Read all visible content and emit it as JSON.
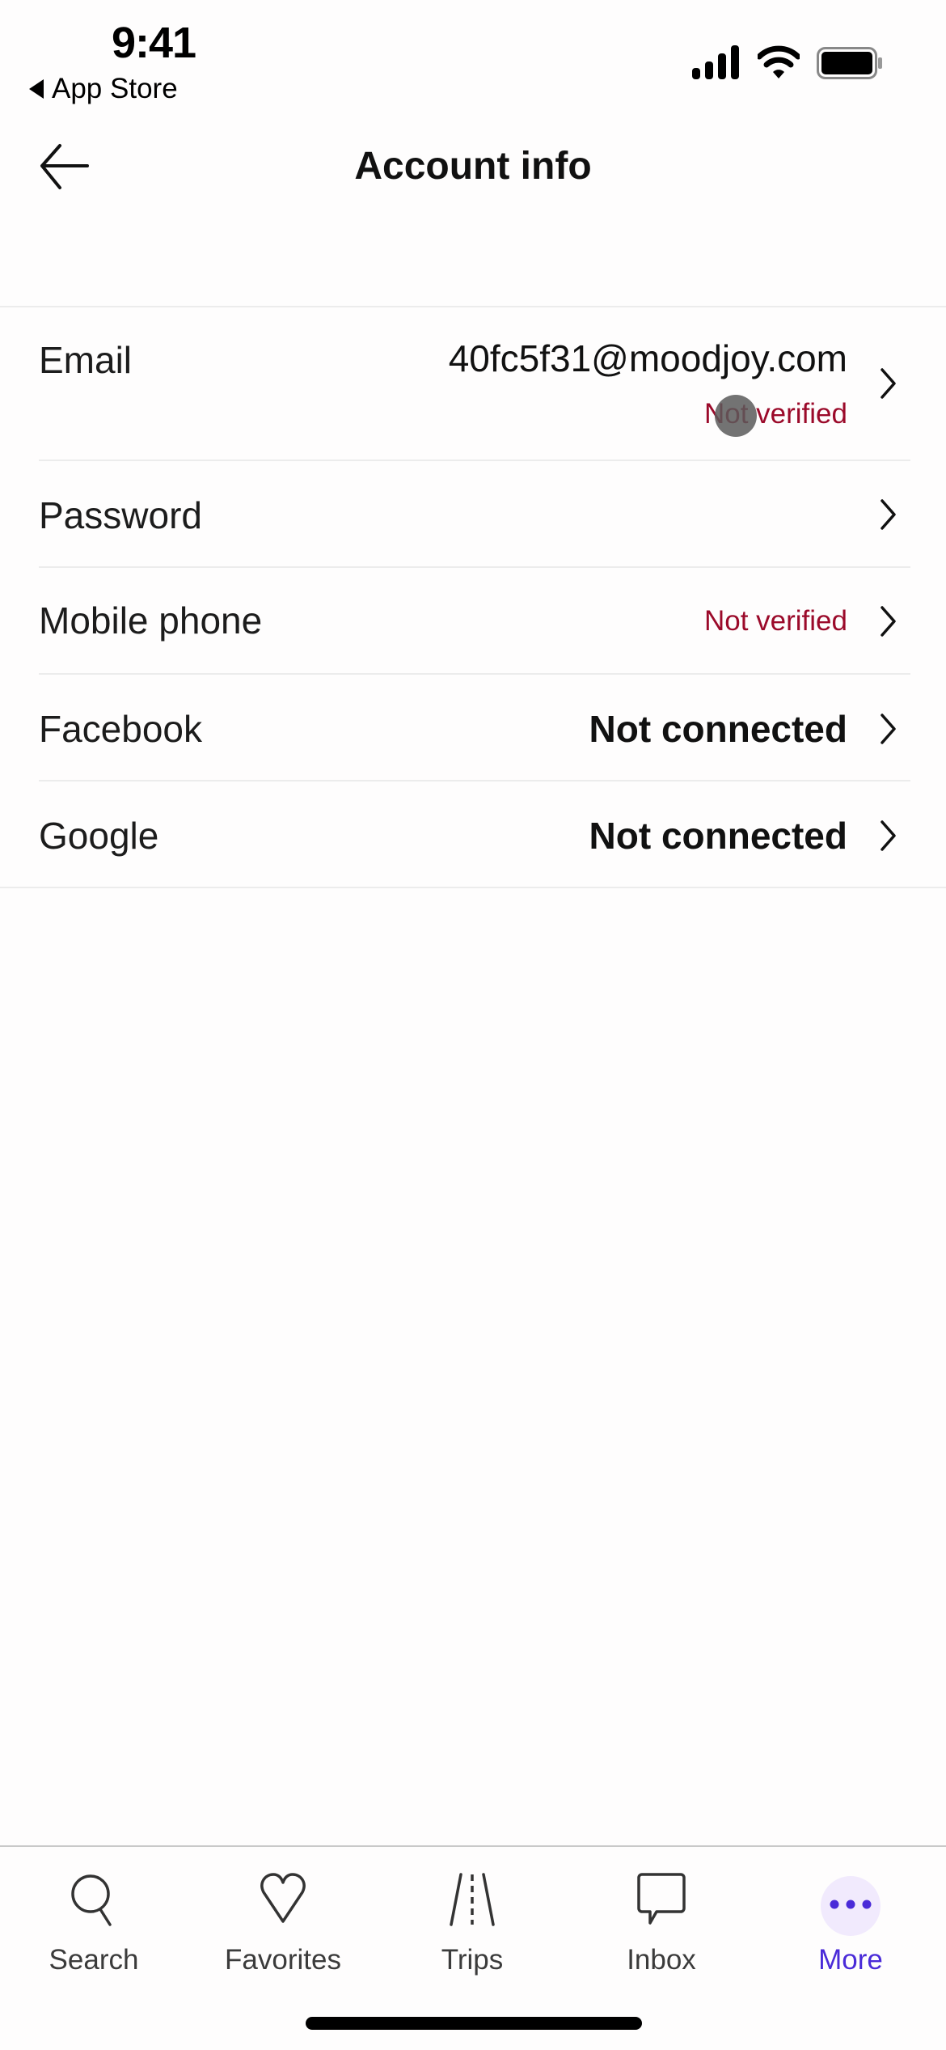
{
  "status_bar": {
    "time": "9:41",
    "back_app": "App Store"
  },
  "header": {
    "title": "Account info",
    "back_icon": "arrow-left-icon"
  },
  "rows": [
    {
      "label": "Email",
      "value": "40fc5f31@moodjoy.com",
      "sub": "Not verified"
    },
    {
      "label": "Password",
      "value": ""
    },
    {
      "label": "Mobile phone",
      "value": "Not verified"
    },
    {
      "label": "Facebook",
      "value": "Not connected"
    },
    {
      "label": "Google",
      "value": "Not connected"
    }
  ],
  "colors": {
    "warning": "#9b0a2a",
    "accent": "#4a2bd8",
    "accent_bg": "#f1eafd"
  },
  "tabbar": {
    "tabs": [
      {
        "label": "Search",
        "icon": "search-icon"
      },
      {
        "label": "Favorites",
        "icon": "heart-icon"
      },
      {
        "label": "Trips",
        "icon": "road-icon"
      },
      {
        "label": "Inbox",
        "icon": "chat-bubble-icon"
      },
      {
        "label": "More",
        "icon": "more-dots-icon",
        "active": true
      }
    ]
  }
}
